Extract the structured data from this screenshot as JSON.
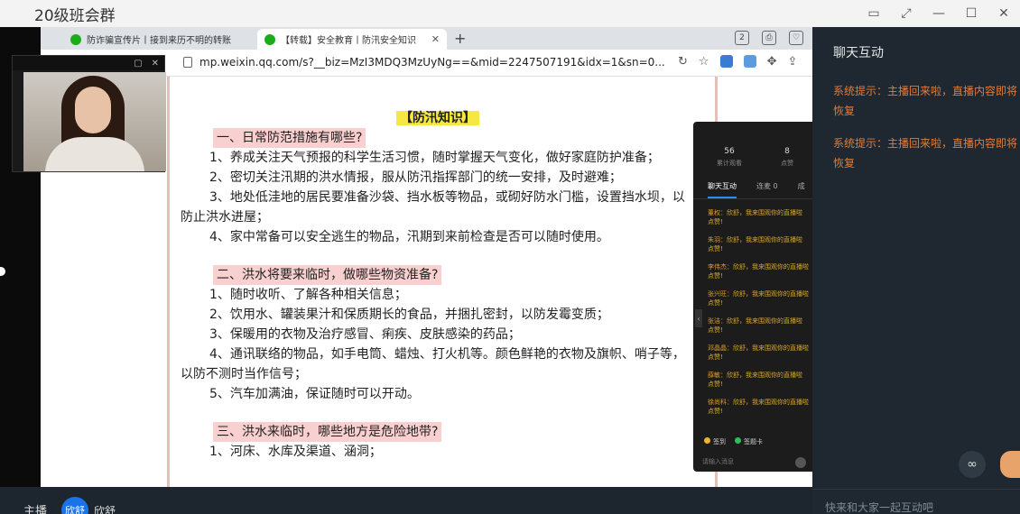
{
  "window": {
    "title": "20级班会群"
  },
  "browser": {
    "tabs": [
      {
        "label": "防诈骗宣传片丨接到来历不明的转账"
      },
      {
        "label": "【转载】安全教育丨防汛安全知识"
      }
    ],
    "url": "mp.weixin.qq.com/s?__biz=MzI3MDQ3MzUyNg==&mid=2247507191&idx=1&sn=0..."
  },
  "article": {
    "title": "【防汛知识】",
    "sections": [
      {
        "heading": "一、日常防范措施有哪些?",
        "items": [
          "1、养成关注天气预报的科学生活习惯，随时掌握天气变化，做好家庭防护准备；",
          "2、密切关注汛期的洪水情报，服从防汛指挥部门的统一安排，及时避难；",
          "3、地处低洼地的居民要准备沙袋、挡水板等物品，或砌好防水门槛，设置挡水坝，以防止洪水进屋；",
          "4、家中常备可以安全逃生的物品，汛期到来前检查是否可以随时使用。"
        ]
      },
      {
        "heading": "二、洪水将要来临时，做哪些物资准备?",
        "items": [
          "1、随时收听、了解各种相关信息；",
          "2、饮用水、罐装果汁和保质期长的食品，并捆扎密封，以防发霉变质；",
          "3、保暖用的衣物及治疗感冒、痢疾、皮肤感染的药品；",
          "4、通讯联络的物品，如手电筒、蜡烛、打火机等。颜色鲜艳的衣物及旗帜、哨子等，以防不测时当作信号；",
          "5、汽车加满油，保证随时可以开动。"
        ]
      },
      {
        "heading": "三、洪水来临时，哪些地方是危险地带?",
        "items": [
          "1、河床、水库及渠道、涵洞；"
        ]
      }
    ]
  },
  "mini_panel": {
    "stats": [
      {
        "value": "56",
        "label": "累计观看"
      },
      {
        "value": "8",
        "label": "点赞"
      }
    ],
    "tabs": [
      "聊天互动",
      "连麦 0",
      "成"
    ],
    "messages": [
      {
        "name": "董权：",
        "text": "欣舒，我来围观你的直播啦",
        "tail": "点赞!"
      },
      {
        "name": "朱羽：",
        "text": "欣舒，我来围观你的直播啦",
        "tail": "点赞!"
      },
      {
        "name": "李伟杰：",
        "text": "欣舒，我来围观你的直播啦",
        "tail": "点赞!"
      },
      {
        "name": "张兴旺：",
        "text": "欣舒，我来围观你的直播啦",
        "tail": "点赞!"
      },
      {
        "name": "张洁：",
        "text": "欣舒，我来围观你的直播啦",
        "tail": "点赞!"
      },
      {
        "name": "邓晶晶：",
        "text": "欣舒，我来围观你的直播啦",
        "tail": "点赞!"
      },
      {
        "name": "薛敏：",
        "text": "欣舒，我来围观你的直播啦",
        "tail": "点赞!"
      },
      {
        "name": "徐尚科：",
        "text": "欣舒，我来围观你的直播啦",
        "tail": "点赞!"
      }
    ],
    "footer": {
      "sign_in": "签到",
      "check_card": "签题卡"
    },
    "input_placeholder": "请输入消息"
  },
  "chat_panel": {
    "title": "聊天互动",
    "system_messages": [
      "系统提示：主播回来啦，直播内容即将恢复",
      "系统提示：主播回来啦，直播内容即将恢复"
    ],
    "input_placeholder": "快来和大家一起互动吧"
  },
  "bottom": {
    "host_label": "主播",
    "host_avatar_text": "欣舒",
    "host_name": "欣舒"
  }
}
